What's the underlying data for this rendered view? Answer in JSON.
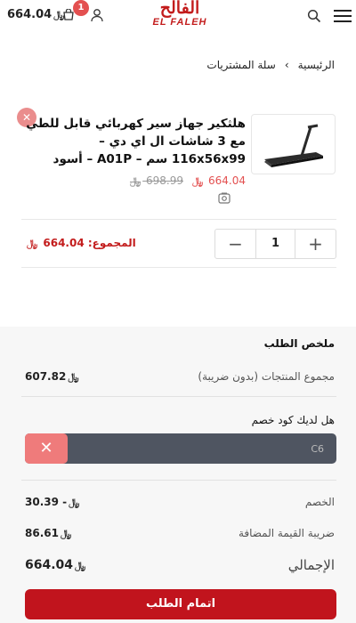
{
  "header": {
    "cart_total": "664.04",
    "currency_symbol": "⃁",
    "cart_count": "1",
    "logo_arabic": "الفالح",
    "logo_english": "EL FALEH"
  },
  "breadcrumb": {
    "home": "الرئيسية",
    "separator": "›",
    "current": "سلة المشتريات"
  },
  "cart_item": {
    "remove_label": "✕",
    "title": "هلثكير جهاز سير كهربائي قابل للطي مع 3 شاشات ال اي دي – 116x56x99 سم – A01P – أسود",
    "old_price": "698.99",
    "new_price": "664.04",
    "quantity": "1",
    "minus_label": "−",
    "plus_label": "+",
    "line_total_label": "المجموع:",
    "line_total_value": "664.04"
  },
  "summary": {
    "title": "ملخص الطلب",
    "subtotal_label": "مجموع المنتجات (بدون ضريبة)",
    "subtotal_value": "607.82",
    "coupon_question": "هل لديك كود خصم",
    "coupon_value": "C6",
    "coupon_clear_label": "✕",
    "discount_label": "الخصم",
    "discount_value": "- 30.39",
    "vat_label": "ضريبة القيمة المضافة",
    "vat_value": "86.61",
    "total_label": "الإجمالي",
    "total_value": "664.04",
    "checkout_label": "اتمام الطلب"
  },
  "colors": {
    "brand_red": "#c1141d",
    "badge_red": "#e35050",
    "coupon_field": "#4f5561",
    "coupon_clear": "#ef7b7b"
  }
}
